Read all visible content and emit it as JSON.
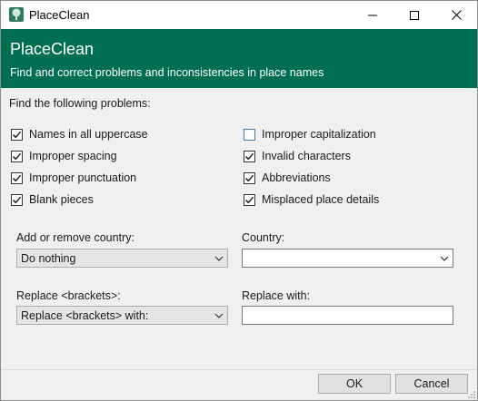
{
  "window": {
    "title": "PlaceClean",
    "controls": {
      "minimize": "minimize-icon",
      "maximize": "maximize-icon",
      "close": "close-icon"
    }
  },
  "banner": {
    "heading": "PlaceClean",
    "subtitle": "Find and correct problems and inconsistencies in place names",
    "color": "#006e51"
  },
  "problems": {
    "label": "Find the following problems:",
    "items": [
      {
        "label": "Names in all uppercase",
        "checked": true
      },
      {
        "label": "Improper capitalization",
        "checked": false
      },
      {
        "label": "Improper spacing",
        "checked": true
      },
      {
        "label": "Invalid characters",
        "checked": true
      },
      {
        "label": "Improper punctuation",
        "checked": true
      },
      {
        "label": "Abbreviations",
        "checked": true
      },
      {
        "label": "Blank pieces",
        "checked": true
      },
      {
        "label": "Misplaced place details",
        "checked": true
      }
    ]
  },
  "country_action": {
    "label": "Add or remove country:",
    "value": "Do nothing"
  },
  "country": {
    "label": "Country:",
    "value": ""
  },
  "brackets": {
    "label": "Replace <brackets>:",
    "value": "Replace <brackets> with:"
  },
  "replace_with": {
    "label": "Replace with:",
    "value": ""
  },
  "buttons": {
    "ok": "OK",
    "cancel": "Cancel"
  }
}
